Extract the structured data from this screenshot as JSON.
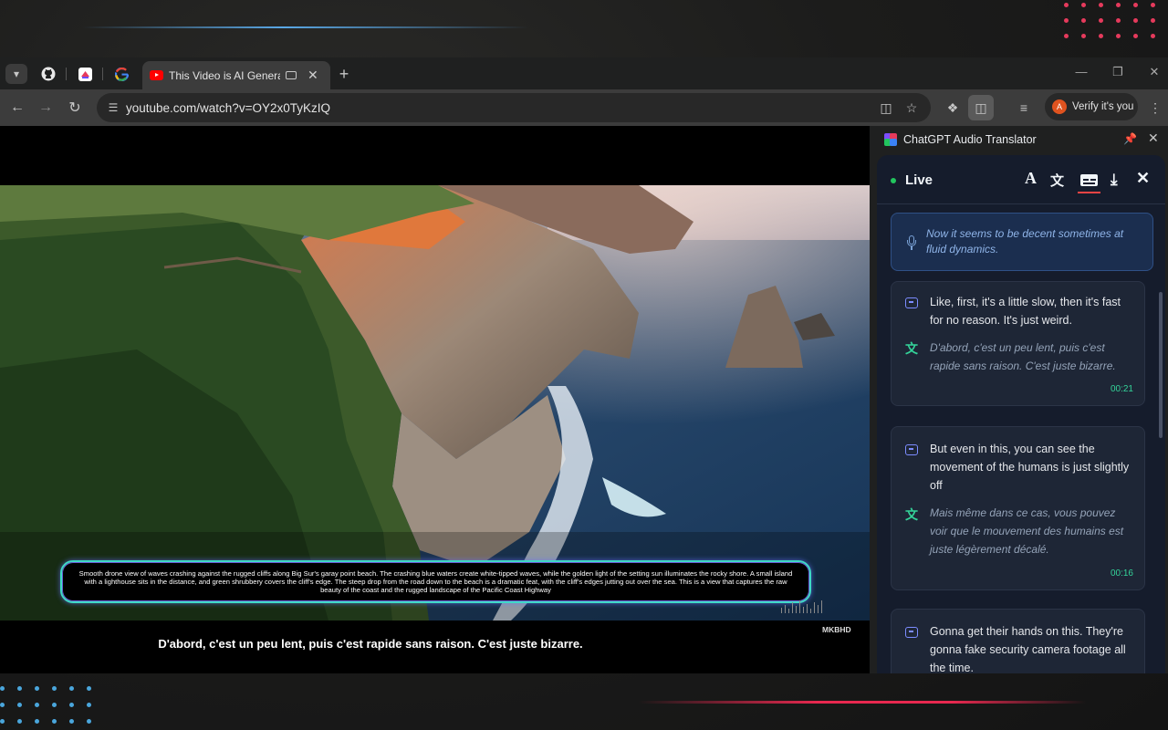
{
  "browser": {
    "tab_title": "This Video is AI Generated!",
    "url": "youtube.com/watch?v=OY2x0TyKzIQ",
    "verify_label": "Verify it's you",
    "verify_avatar": "A"
  },
  "video": {
    "description": "Smooth drone view of waves crashing against the rugged cliffs along Big Sur's garay point beach. The crashing blue waters create white-tipped waves, while the golden light of the setting sun illuminates the rocky shore. A small island with a lighthouse sits in the distance, and green shrubbery covers the cliff's edge.  The steep drop from the road down to the beach is a dramatic feat, with the cliff's edges jutting out over the sea. This is a view that captures the raw beauty of the coast and the rugged landscape of the Pacific Coast Highway",
    "channel_watermark": "MKBHD",
    "subtitle": "D'abord, c'est un peu lent, puis c'est rapide sans raison. C'est juste bizarre."
  },
  "side_panel": {
    "title": "ChatGPT Audio Translator",
    "live_label": "Live",
    "live_transcript": "Now it seems to be decent sometimes at fluid dynamics.",
    "cards": [
      {
        "original": "Like, first, it's a little slow, then it's fast for no reason. It's just weird.",
        "translation": "D'abord, c'est un peu lent, puis c'est rapide sans raison. C'est juste bizarre.",
        "time": "00:21"
      },
      {
        "original": "But even in this, you can see the movement of the humans is just slightly off",
        "translation": "Mais même dans ce cas, vous pouvez voir que le mouvement des humains est juste légèrement décalé.",
        "time": "00:16"
      },
      {
        "original": "Gonna get their hands on this. They're gonna fake security camera footage all the time.",
        "translation": "",
        "time": ""
      }
    ]
  },
  "colors": {
    "accent_live": "#22c55e",
    "accent_time": "#34d399",
    "active_underline": "#ef4444"
  },
  "icons": [
    "tab-search-icon",
    "github-icon",
    "app-icon",
    "google-icon",
    "youtube-icon",
    "media-icon",
    "close-icon",
    "new-tab-icon",
    "back-icon",
    "forward-icon",
    "reload-icon",
    "site-info-icon",
    "install-icon",
    "star-icon",
    "extensions-icon",
    "side-panel-icon",
    "reading-list-icon",
    "menu-icon",
    "pin-icon",
    "mic-icon",
    "message-icon",
    "translate-icon",
    "font-icon",
    "captions-icon",
    "download-icon"
  ]
}
